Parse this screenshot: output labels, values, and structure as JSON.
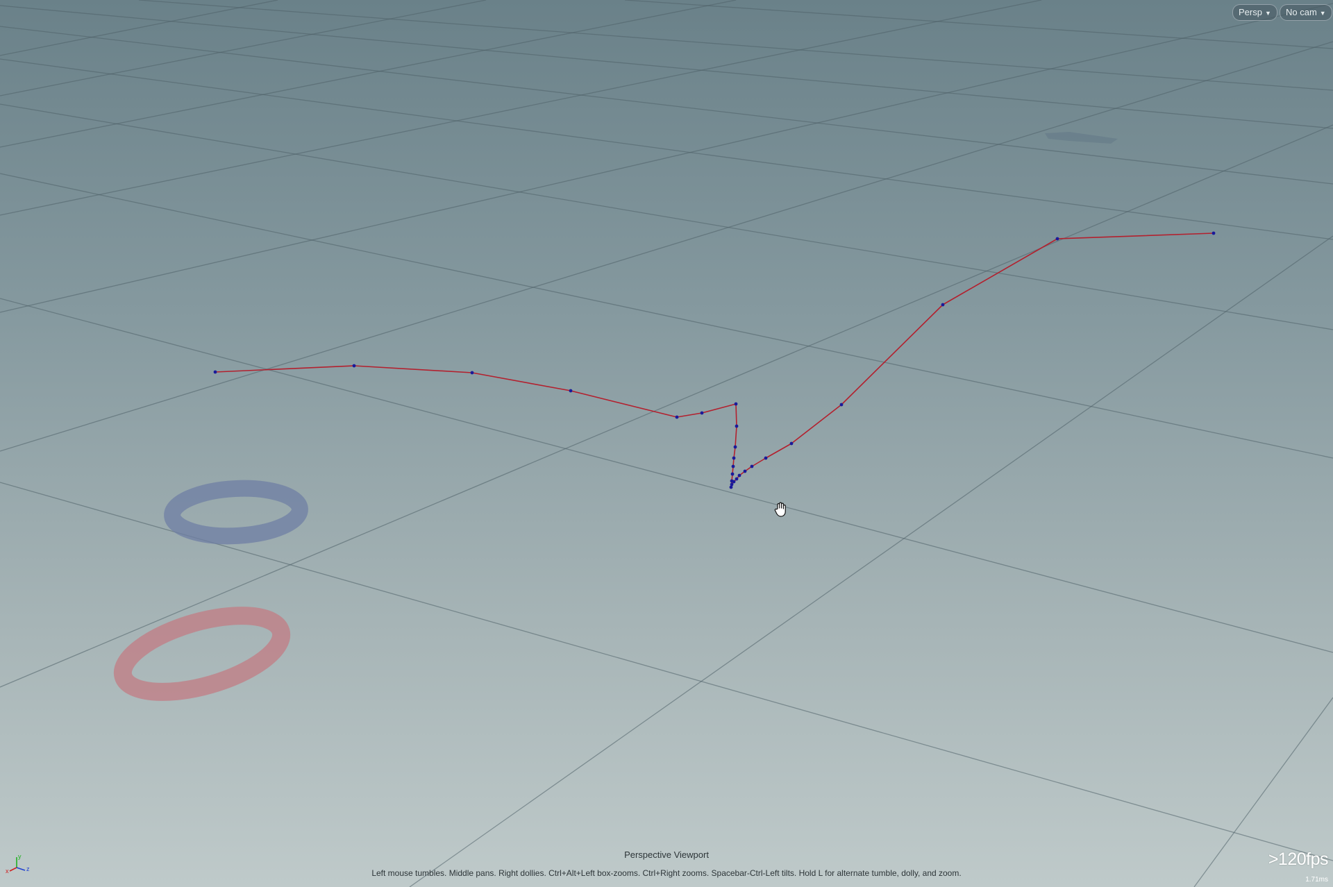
{
  "viewport": {
    "title": "Perspective Viewport",
    "hint": "Left mouse tumbles. Middle pans. Right dollies. Ctrl+Alt+Left box-zooms. Ctrl+Right zooms. Spacebar-Ctrl-Left tilts. Hold L for alternate tumble, dolly, and zoom.",
    "fps": ">120fps",
    "frame_time": "1.71ms"
  },
  "camera_menu": {
    "persp_label": "Persp",
    "cam_label": "No cam"
  },
  "axes": {
    "x": "x",
    "y": "y",
    "z": "z"
  },
  "colors": {
    "curve": "#b3202e",
    "points": "#1a1a9a",
    "grid": "#4f6168",
    "z_marker": "#6f7fa4",
    "x_marker": "#c07f87",
    "axis_x": "#d02020",
    "axis_y": "#20b020",
    "axis_z": "#2040d0"
  },
  "icons": {
    "cursor": "hand-cursor-icon"
  }
}
